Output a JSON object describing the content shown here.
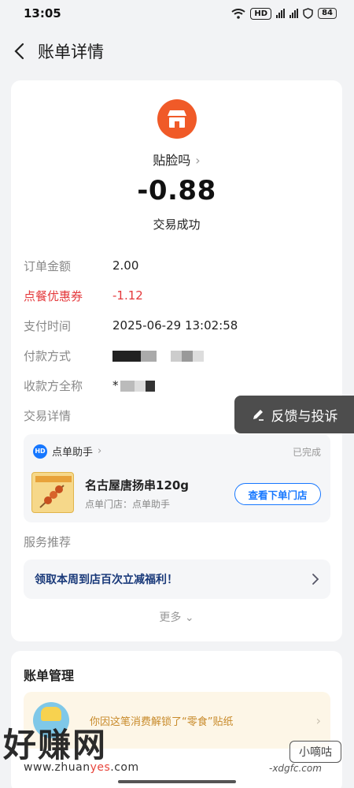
{
  "status_bar": {
    "time": "13:05",
    "hd": "HD",
    "battery": "84"
  },
  "nav": {
    "title": "账单详情"
  },
  "bill": {
    "merchant": "贴脸吗",
    "amount": "-0.88",
    "status": "交易成功",
    "rows": [
      {
        "label": "订单金额",
        "value": "2.00"
      },
      {
        "label": "点餐优惠券",
        "value": "-1.12"
      },
      {
        "label": "支付时间",
        "value": "2025-06-29 13:02:58"
      },
      {
        "label": "付款方式",
        "value": ""
      },
      {
        "label": "收款方全称",
        "value": "*"
      },
      {
        "label": "交易详情",
        "value": ""
      }
    ]
  },
  "order": {
    "helper": "点单助手",
    "helper_logo": "HD",
    "status": "已完成",
    "item_name": "名古屋唐扬串120g",
    "store": "点单门店：点单助手",
    "store_button": "查看下单门店"
  },
  "services": {
    "label": "服务推荐",
    "promo": "领取本周到店百次立减福利！",
    "more": "更多"
  },
  "feedback": {
    "label": "反馈与投诉"
  },
  "manage": {
    "title": "账单管理",
    "sticker_text": "你因这笔消费解锁了“零食”贴纸"
  },
  "watermarks": {
    "left_big": "好赚网",
    "url_prefix": "www.zhuan",
    "url_highlight": "yes",
    "url_suffix": ".com",
    "right_small": "小嘀咕",
    "right_site": "-xdgfc.com"
  },
  "colors": {
    "accent": "#1677ff",
    "merchant": "#f05a28",
    "discount": "#e4393c"
  }
}
